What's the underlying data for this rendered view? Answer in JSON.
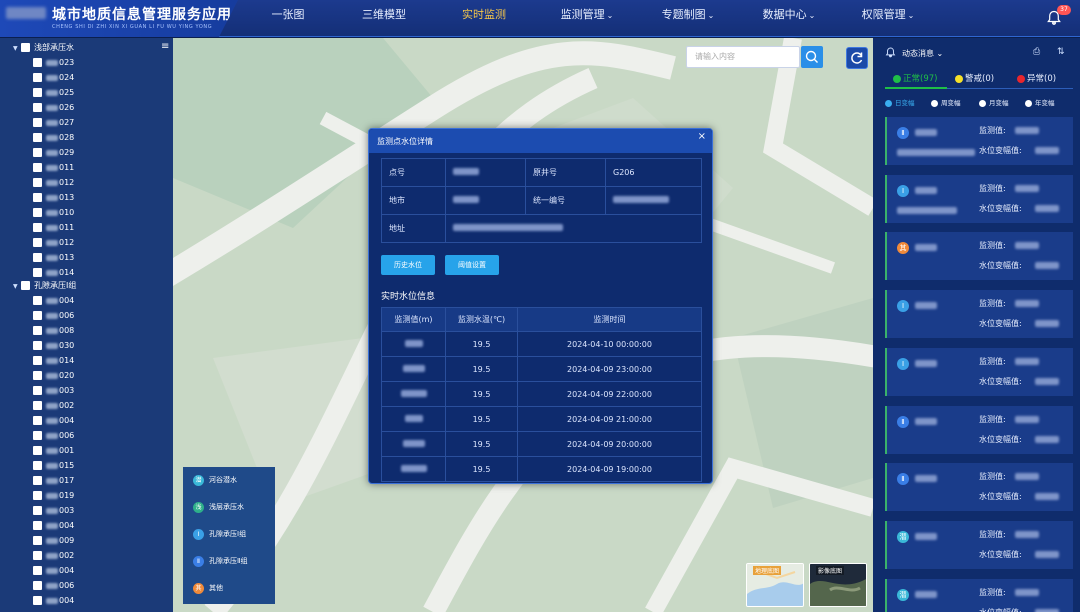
{
  "app": {
    "title": "城市地质信息管理服务应用",
    "subtitle": "CHENG SHI DI ZHI XIN XI GUAN LI FU WU YING YONG",
    "notification_count": "37"
  },
  "nav": [
    {
      "label": "一张图"
    },
    {
      "label": "三维模型"
    },
    {
      "label": "实时监测"
    },
    {
      "label": "监测管理",
      "dropdown": true
    },
    {
      "label": "专题制图",
      "dropdown": true
    },
    {
      "label": "数据中心",
      "dropdown": true
    },
    {
      "label": "权限管理",
      "dropdown": true
    }
  ],
  "tree": {
    "group1": {
      "label": "浅部承压水",
      "items": [
        "023",
        "024",
        "025",
        "026",
        "027",
        "028",
        "029",
        "011",
        "012",
        "013",
        "010",
        "011",
        "012",
        "013",
        "014"
      ]
    },
    "group2": {
      "label": "孔隙承压Ⅰ组",
      "items": [
        "004",
        "006",
        "008",
        "030",
        "014",
        "020",
        "003",
        "002",
        "004",
        "006",
        "001",
        "015",
        "017",
        "019",
        "003",
        "004",
        "009",
        "002",
        "004",
        "006",
        "004"
      ]
    }
  },
  "search": {
    "placeholder": "请输入内容"
  },
  "legend": [
    {
      "label": "河谷潜水",
      "icon": "潜",
      "color": "#3ab8d8"
    },
    {
      "label": "浅层承压水",
      "icon": "浅",
      "color": "#2eb08a"
    },
    {
      "label": "孔隙承压Ⅰ组",
      "icon": "Ⅰ",
      "color": "#3aa0e6"
    },
    {
      "label": "孔隙承压Ⅱ组",
      "icon": "Ⅱ",
      "color": "#3a7ee6"
    },
    {
      "label": "其他",
      "icon": "其",
      "color": "#f08a3a"
    }
  ],
  "basemaps": {
    "geo": "地理底图",
    "image": "影像底图"
  },
  "dialog": {
    "title": "监测点水位详情",
    "fields": {
      "point_no_label": "点号",
      "well_no_label": "原井号",
      "well_no_value": "G206",
      "location_label": "地市",
      "unified_no_label": "统一编号",
      "address_label": "地址"
    },
    "buttons": {
      "history": "历史水位",
      "threshold": "阈值设置"
    },
    "section_title": "实时水位信息",
    "table": {
      "headers": [
        "监测值(m)",
        "监测水温(℃)",
        "监测时间"
      ],
      "rows": [
        {
          "temp": "19.5",
          "time": "2024-04-10 00:00:00"
        },
        {
          "temp": "19.5",
          "time": "2024-04-09 23:00:00"
        },
        {
          "temp": "19.5",
          "time": "2024-04-09 22:00:00"
        },
        {
          "temp": "19.5",
          "time": "2024-04-09 21:00:00"
        },
        {
          "temp": "19.5",
          "time": "2024-04-09 20:00:00"
        },
        {
          "temp": "19.5",
          "time": "2024-04-09 19:00:00"
        }
      ]
    }
  },
  "right": {
    "title": "动态消息",
    "status": {
      "normal": "正常(97)",
      "warning": "警戒(0)",
      "abnormal": "异常(0)"
    },
    "periods": [
      "日变幅",
      "周变幅",
      "月变幅",
      "年变幅"
    ],
    "card_labels": {
      "value": "监测值:",
      "change": "水位变幅值:"
    },
    "cards": [
      {
        "icon": "Ⅱ",
        "color": "#3a7ee6"
      },
      {
        "icon": "Ⅰ",
        "color": "#3aa0e6"
      },
      {
        "icon": "其",
        "color": "#f08a3a"
      },
      {
        "icon": "Ⅰ",
        "color": "#3aa0e6"
      },
      {
        "icon": "Ⅰ",
        "color": "#3aa0e6"
      },
      {
        "icon": "Ⅱ",
        "color": "#3a7ee6"
      },
      {
        "icon": "Ⅱ",
        "color": "#3a7ee6"
      },
      {
        "icon": "潜",
        "color": "#3ab8d8"
      },
      {
        "icon": "潜",
        "color": "#3ab8d8"
      }
    ]
  },
  "colors": {
    "normal": "#1fbf47",
    "warning": "#f5e02a",
    "abnormal": "#e8262d",
    "active_nav": "#f3c54a"
  }
}
